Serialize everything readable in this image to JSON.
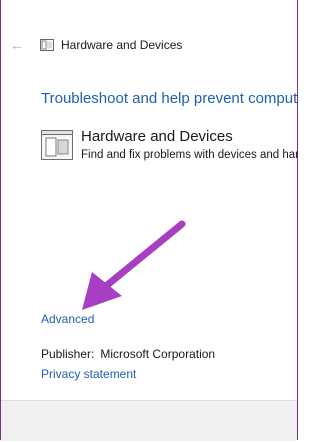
{
  "window": {
    "title": "Hardware and Devices",
    "back_icon": "back-arrow-icon"
  },
  "main": {
    "heading": "Troubleshoot and help prevent computer problems",
    "troubleshooter": {
      "title": "Hardware and Devices",
      "description": "Find and fix problems with devices and hardware.",
      "icon": "hardware-devices-icon"
    },
    "advanced_link": "Advanced",
    "publisher_label": "Publisher:",
    "publisher_value": "Microsoft Corporation",
    "privacy_link": "Privacy statement"
  },
  "annotation": {
    "arrow_color": "#a63fc2"
  },
  "colors": {
    "link": "#1f5fb0",
    "frame": "#7c2d7f",
    "footer": "#f0f0f0"
  }
}
